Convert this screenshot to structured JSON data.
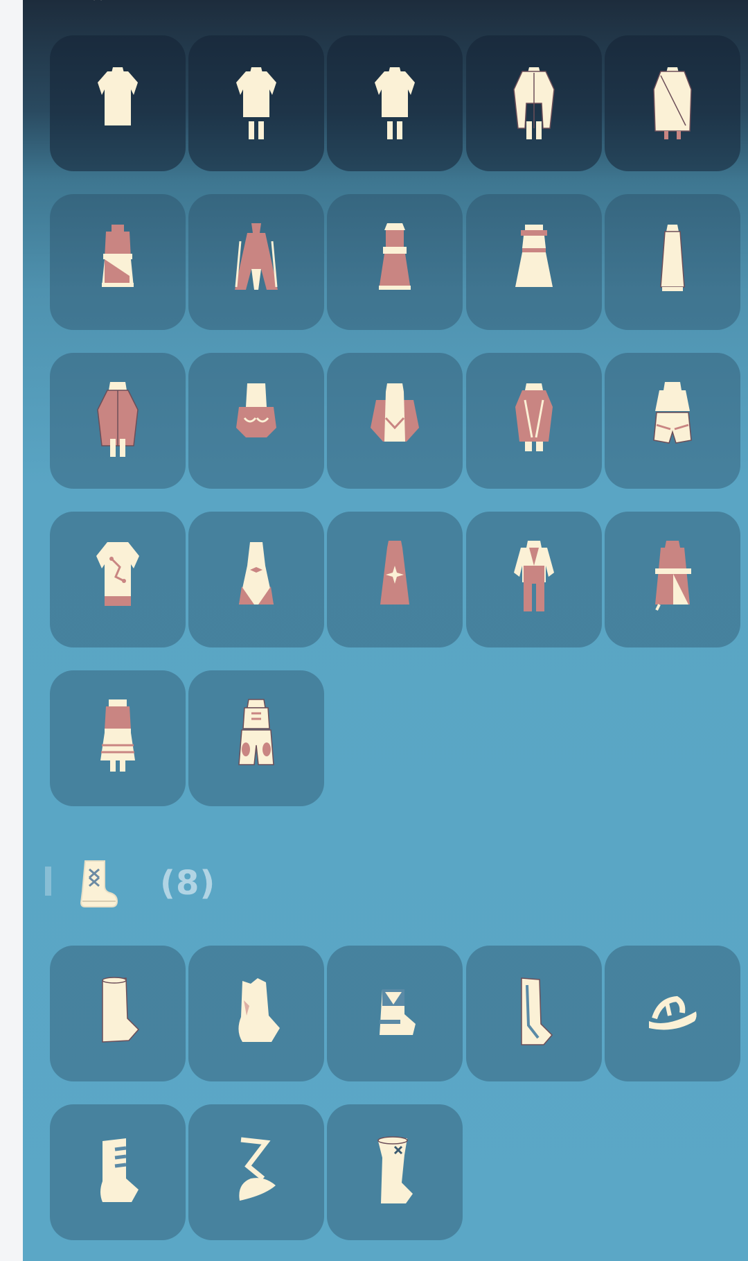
{
  "colors": {
    "cream": "#fbf1d6",
    "rose": "#c98582",
    "outline": "#6c4e58",
    "tile_bg": "#3f7d9a",
    "panel_bg": "#5ba7c6"
  },
  "outfits": {
    "items": [
      {
        "icon": "tunic-icon"
      },
      {
        "icon": "tunic-pants-icon"
      },
      {
        "icon": "tunic-pants-icon"
      },
      {
        "icon": "long-coat-icon"
      },
      {
        "icon": "robe-icon"
      },
      {
        "icon": "wrapped-outfit-icon"
      },
      {
        "icon": "flowing-robe-icon"
      },
      {
        "icon": "dress-icon"
      },
      {
        "icon": "frilled-dress-icon"
      },
      {
        "icon": "simple-dress-icon"
      },
      {
        "icon": "rose-coat-icon"
      },
      {
        "icon": "puffed-outfit-icon"
      },
      {
        "icon": "cape-outfit-icon"
      },
      {
        "icon": "patterned-coat-icon"
      },
      {
        "icon": "harem-outfit-icon"
      },
      {
        "icon": "star-shirt-icon"
      },
      {
        "icon": "bow-dress-icon"
      },
      {
        "icon": "sparkle-gown-icon"
      },
      {
        "icon": "suit-icon"
      },
      {
        "icon": "sash-robe-icon"
      },
      {
        "icon": "apron-dress-icon"
      },
      {
        "icon": "ornate-outfit-icon"
      }
    ]
  },
  "shoes": {
    "count_label": "(8)",
    "header_icon": "boot-icon",
    "items": [
      {
        "icon": "tall-boot-icon"
      },
      {
        "icon": "crumpled-boot-icon"
      },
      {
        "icon": "short-boot-icon"
      },
      {
        "icon": "tall-outlined-boot-icon"
      },
      {
        "icon": "sandal-icon"
      },
      {
        "icon": "strapped-boot-icon"
      },
      {
        "icon": "ribbon-slipper-icon"
      },
      {
        "icon": "buckled-boot-icon"
      }
    ]
  }
}
